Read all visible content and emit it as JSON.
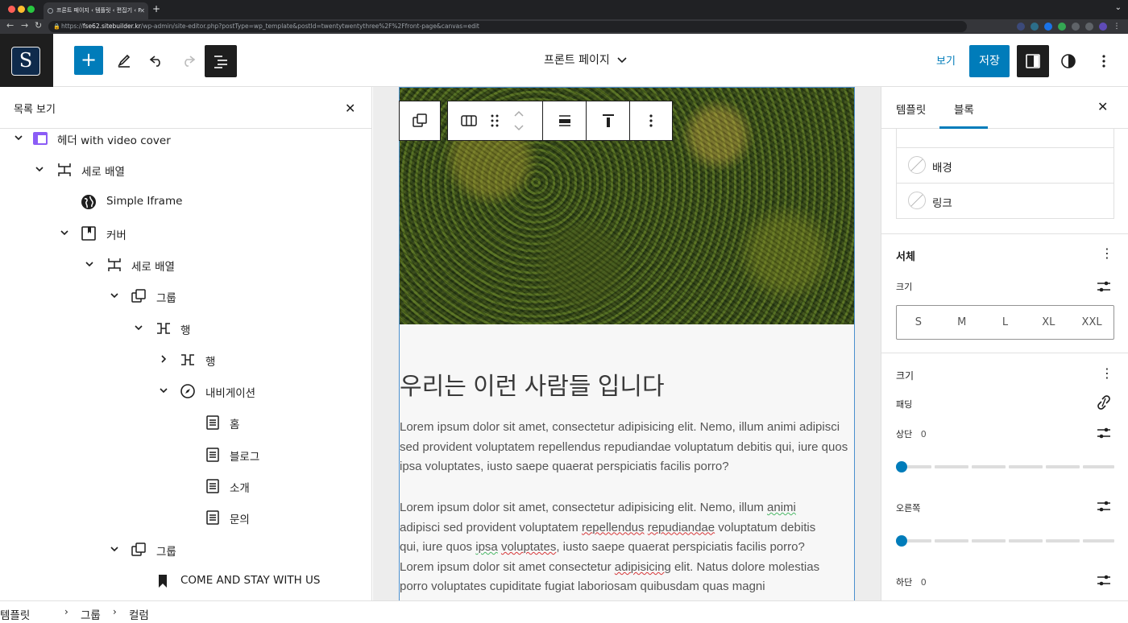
{
  "browser": {
    "tab_title": "프론트 페이지 ‹ 템플릿 ‹ 편집기 ‹ F",
    "url_host": "fse62.sitebuilder.kr",
    "url_path_pre": "https://",
    "url_path_post": "/wp-admin/site-editor.php?postType=wp_template&postId=twentytwentythree%2F%2Ffront-page&canvas=edit"
  },
  "topbar": {
    "site_logo": "S",
    "doc_title": "프론트 페이지",
    "view_label": "보기",
    "save_label": "저장"
  },
  "list_view": {
    "title": "목록 보기",
    "items": [
      {
        "label": "헤더 with video cover"
      },
      {
        "label": "세로 배열"
      },
      {
        "label": "Simple Iframe"
      },
      {
        "label": "커버"
      },
      {
        "label": "세로 배열"
      },
      {
        "label": "그룹"
      },
      {
        "label": "행"
      },
      {
        "label": "행"
      },
      {
        "label": "내비게이션"
      },
      {
        "label": "홈"
      },
      {
        "label": "블로그"
      },
      {
        "label": "소개"
      },
      {
        "label": "문의"
      },
      {
        "label": "그룹"
      },
      {
        "label": "COME AND STAY WITH US"
      }
    ]
  },
  "canvas": {
    "heading": "우리는 이런 사람들 입니다",
    "para1": "Lorem ipsum dolor sit amet, consectetur adipisicing elit. Nemo, illum animi adipisci sed provident voluptatem repellendus repudiandae voluptatum debitis qui, iure quos ipsa voluptates, iusto saepe quaerat perspiciatis facilis porro?",
    "para2": {
      "l1a": "Lorem ipsum dolor sit amet, consectetur adipisicing elit. Nemo, illum ",
      "l1b": "animi",
      "l2a": "adipisci sed provident voluptatem ",
      "l2b": "repellendus",
      "l2c": " ",
      "l2d": "repudiandae",
      "l2e": " voluptatum debitis",
      "l3a": "qui, iure quos ",
      "l3b": "ipsa",
      "l3c": " ",
      "l3d": "voluptates",
      "l3e": ", iusto saepe quaerat perspiciatis facilis porro?",
      "l4a": "Lorem ipsum dolor sit amet consectetur ",
      "l4b": "adipisicing",
      "l4c": " elit. Natus dolore molestias",
      "l5": "porro voluptates cupiditate fugiat laboriosam quibusdam quas magni"
    }
  },
  "sidebar": {
    "tab_template": "템플릿",
    "tab_block": "블록",
    "colors": [
      "배경",
      "링크"
    ],
    "typography_title": "서체",
    "size_label": "크기",
    "font_sizes": [
      "S",
      "M",
      "L",
      "XL",
      "XXL"
    ],
    "dimensions_title": "크기",
    "padding_label": "패딩",
    "top_label": "상단",
    "top_value": "0",
    "right_label": "오른쪽",
    "bottom_label": "하단",
    "bottom_value": "0"
  },
  "breadcrumbs": [
    "템플릿",
    "그룹",
    "컬럼"
  ]
}
